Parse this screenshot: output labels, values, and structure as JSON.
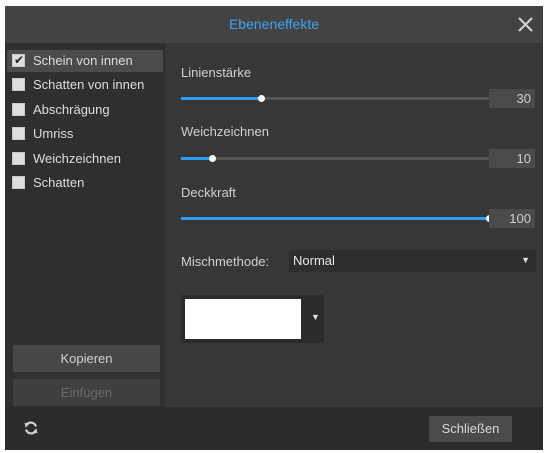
{
  "dialog": {
    "title": "Ebeneneffekte"
  },
  "effects": [
    {
      "label": "Schein von innen",
      "checked": true
    },
    {
      "label": "Schatten von innen",
      "checked": false
    },
    {
      "label": "Abschrägung",
      "checked": false
    },
    {
      "label": "Umriss",
      "checked": false
    },
    {
      "label": "Weichzeichnen",
      "checked": false
    },
    {
      "label": "Schatten",
      "checked": false
    }
  ],
  "sidebar": {
    "copy_label": "Kopieren",
    "paste_label": "Einfügen"
  },
  "params": {
    "stroke": {
      "label": "Linienstärke",
      "value": "30",
      "level_pct": 26
    },
    "blur": {
      "label": "Weichzeichnen",
      "value": "10",
      "level_pct": 10
    },
    "opacity": {
      "label": "Deckkraft",
      "value": "100",
      "level_pct": 100
    }
  },
  "blend": {
    "label": "Mischmethode:",
    "value": "Normal"
  },
  "color": {
    "swatch": "#ffffff"
  },
  "footer": {
    "close_label": "Schließen"
  },
  "colors": {
    "accent": "#2e9cf0",
    "title": "#3fa3f2"
  },
  "icons": {
    "close": "close-icon",
    "refresh": "refresh-icon",
    "check": "check-icon",
    "dropdown": "chevron-down-icon"
  }
}
